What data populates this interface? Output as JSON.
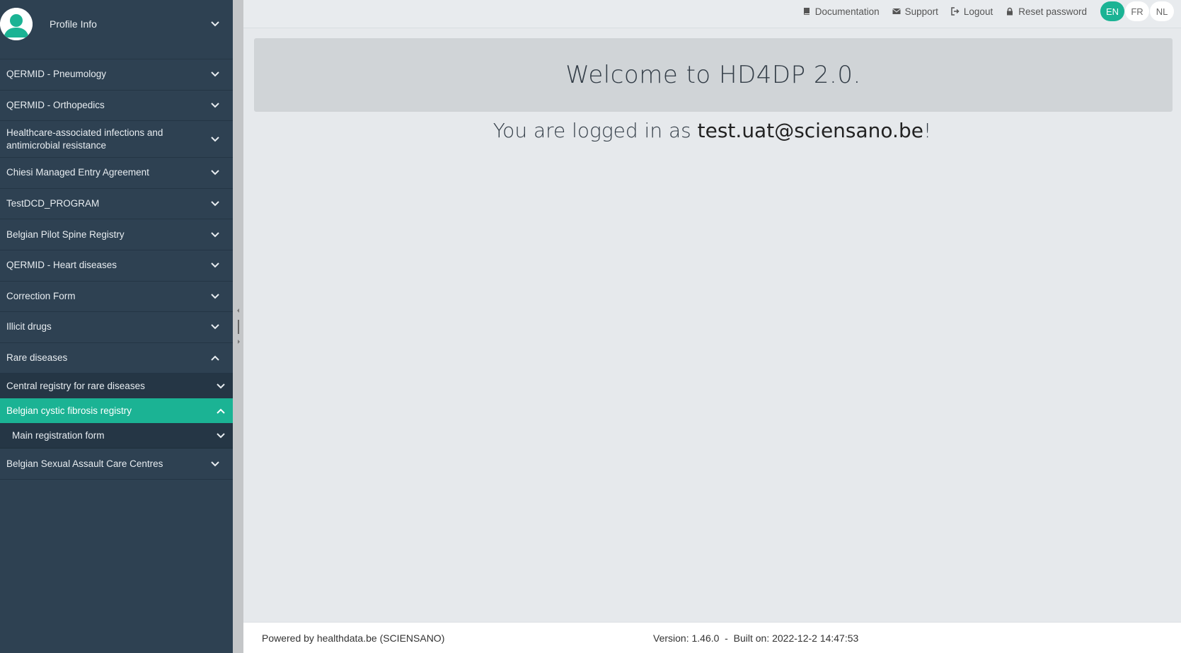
{
  "profile": {
    "label": "Profile Info"
  },
  "sidebar": {
    "items": [
      {
        "label": "QERMID - Pneumology"
      },
      {
        "label": "QERMID - Orthopedics"
      },
      {
        "label": "Healthcare-associated infections and antimicrobial resistance"
      },
      {
        "label": "Chiesi Managed Entry Agreement"
      },
      {
        "label": "TestDCD_PROGRAM"
      },
      {
        "label": "Belgian Pilot Spine Registry"
      },
      {
        "label": "QERMID - Heart diseases"
      },
      {
        "label": "Correction Form"
      },
      {
        "label": "Illicit drugs"
      },
      {
        "label": "Rare diseases"
      },
      {
        "label": "Belgian Sexual Assault Care Centres"
      }
    ],
    "rare_sub": [
      {
        "label": "Central registry for rare diseases"
      },
      {
        "label": "Belgian cystic fibrosis registry"
      },
      {
        "label": "Main registration form"
      }
    ]
  },
  "topbar": {
    "documentation": "Documentation",
    "support": "Support",
    "logout": "Logout",
    "reset_password": "Reset password",
    "languages": [
      "EN",
      "FR",
      "NL"
    ],
    "active_language": "EN"
  },
  "main": {
    "welcome": "Welcome to HD4DP 2.0.",
    "logged_prefix": "You are logged in as ",
    "email": "test.uat@sciensano.be",
    "logged_suffix": "!"
  },
  "footer": {
    "powered": "Powered by healthdata.be (SCIENSANO)",
    "version": "Version: 1.46.0  -  Built on: 2022-12-2 14:47:53"
  },
  "colors": {
    "sidebar_bg": "#2e4152",
    "accent": "#1bb394",
    "welcome_bg": "#d0d4d7"
  }
}
